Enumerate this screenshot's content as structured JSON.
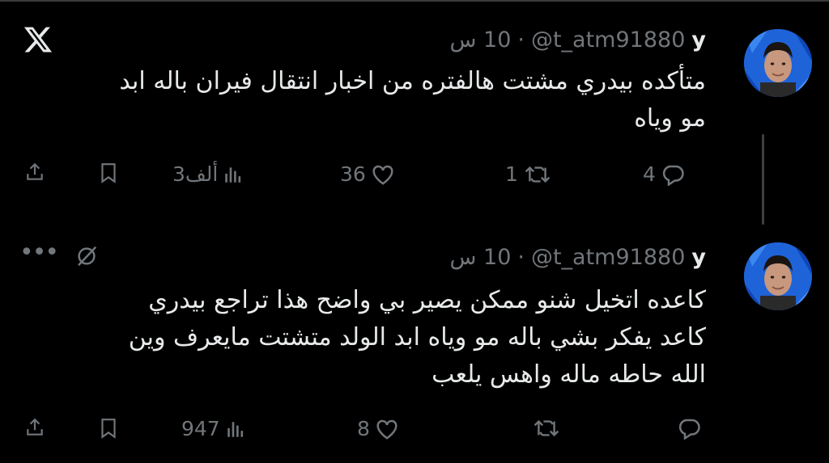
{
  "tweets": [
    {
      "name": "y",
      "handle": "@t_atm91880",
      "separator": "·",
      "time": "10 س",
      "lines": [
        "متأكده بيدري مشتت هالفتره من اخبار انتقال فيران باله ابد",
        "مو وياه"
      ],
      "replies": "4",
      "retweets": "1",
      "likes": "36",
      "views": "3ألف"
    },
    {
      "name": "y",
      "handle": "@t_atm91880",
      "separator": "·",
      "time": "10 س",
      "lines": [
        "كاعده اتخيل شنو ممكن يصير بي واضح هذا تراجع بيدري",
        "كاعد يفكر بشي باله مو وياه ابد الولد متشتت مايعرف وين",
        "الله حاطه ماله واهس يلعب"
      ],
      "replies": "",
      "retweets": "",
      "likes": "8",
      "views": "947"
    }
  ],
  "icons": [
    "x-logo-icon",
    "reply-icon",
    "retweet-icon",
    "like-icon",
    "views-icon",
    "bookmark-icon",
    "share-icon",
    "more-icon",
    "grok-icon"
  ],
  "colors": {
    "background": "#000000",
    "text": "#e7e9ea",
    "muted": "#71767b",
    "thread_line": "#3e4144"
  }
}
